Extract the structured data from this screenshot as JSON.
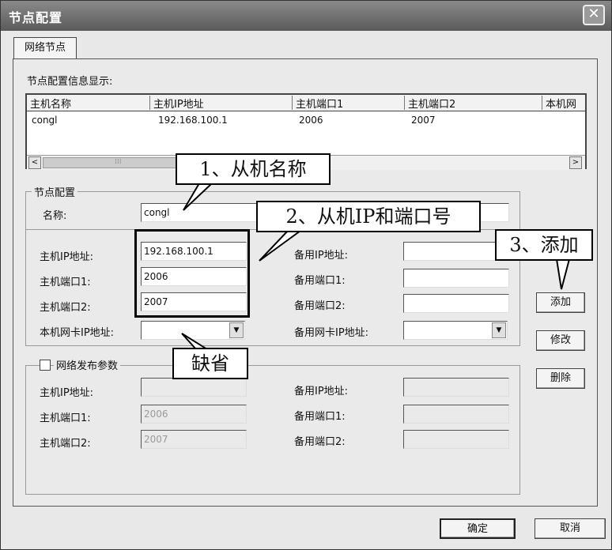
{
  "window": {
    "title": "节点配置",
    "close_glyph": "✕"
  },
  "tab": {
    "label": "网络节点"
  },
  "list_section_label": "节点配置信息显示:",
  "list": {
    "columns": [
      "主机名称",
      "主机IP地址",
      "主机端口1",
      "主机端口2",
      "本机网"
    ],
    "rows": [
      [
        "congl",
        "192.168.100.1",
        "2006",
        "2007"
      ]
    ],
    "scroll_left": "<",
    "scroll_right": ">",
    "scroll_grip": "⁞⁞⁞"
  },
  "node_group": {
    "title": "节点配置",
    "name_label": "名称:",
    "name_value": "congl",
    "host_ip_label": "主机IP地址:",
    "host_ip_value": "192.168.100.1",
    "host_port1_label": "主机端口1:",
    "host_port1_value": "2006",
    "host_port2_label": "主机端口2:",
    "host_port2_value": "2007",
    "nic_label": "本机网卡IP地址:",
    "nic_value": "",
    "backup_ip_label": "备用IP地址:",
    "backup_ip_value": "",
    "backup_port1_label": "备用端口1:",
    "backup_port1_value": "",
    "backup_port2_label": "备用端口2:",
    "backup_port2_value": "",
    "backup_nic_label": "备用网卡IP地址:",
    "backup_nic_value": "",
    "dropdown_arrow": "▼"
  },
  "publish_group": {
    "title": "网络发布参数",
    "checked": false,
    "host_ip_label": "主机IP地址:",
    "host_ip_value": "",
    "host_port1_label": "主机端口1:",
    "host_port1_value": "2006",
    "host_port2_label": "主机端口2:",
    "host_port2_value": "2007",
    "backup_ip_label": "备用IP地址:",
    "backup_ip_value": "",
    "backup_port1_label": "备用端口1:",
    "backup_port1_value": "",
    "backup_port2_label": "备用端口2:",
    "backup_port2_value": ""
  },
  "buttons": {
    "add": "添加",
    "modify": "修改",
    "delete": "删除",
    "ok": "确定",
    "cancel": "取消"
  },
  "annotations": {
    "slave_name": "1、从机名称",
    "slave_ip_port": "2、从机IP和端口号",
    "add_step": "3、添加",
    "default": "缺省"
  }
}
